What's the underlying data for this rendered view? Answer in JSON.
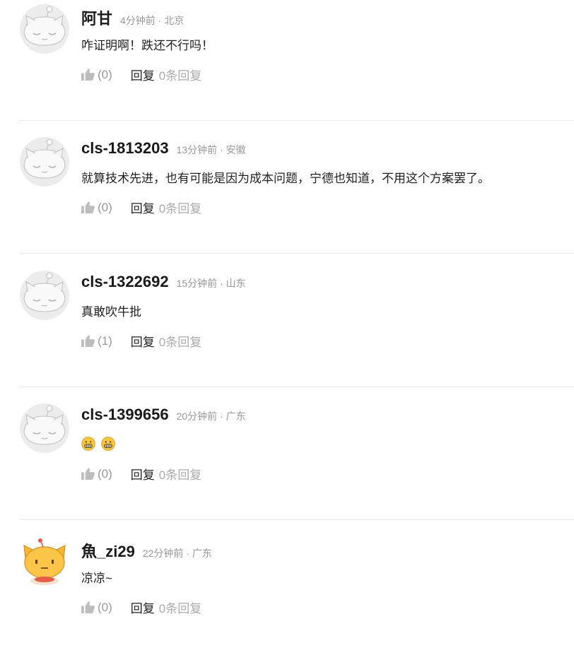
{
  "comments": [
    {
      "username": "阿甘",
      "meta": "4分钟前 · 北京",
      "text": "咋证明啊！跌还不行吗！",
      "likes": "(0)",
      "reply_label": "回复",
      "reply_count": "0条回复",
      "avatar": "default-cat-avatar"
    },
    {
      "username": "cls-1813203",
      "meta": "13分钟前 · 安徽",
      "text": "就算技术先进，也有可能是因为成本问题，宁德也知道，不用这个方案罢了。",
      "likes": "(0)",
      "reply_label": "回复",
      "reply_count": "0条回复",
      "avatar": "default-cat-avatar"
    },
    {
      "username": "cls-1322692",
      "meta": "15分钟前 · 山东",
      "text": "真敢吹牛批",
      "likes": "(1)",
      "reply_label": "回复",
      "reply_count": "0条回复",
      "avatar": "default-cat-avatar"
    },
    {
      "username": "cls-1399656",
      "meta": "20分钟前 · 广东",
      "text": "",
      "emojis": [
        "grimace-emoji",
        "grimace-emoji"
      ],
      "likes": "(0)",
      "reply_label": "回复",
      "reply_count": "0条回复",
      "avatar": "default-cat-avatar"
    },
    {
      "username": "魚_zi29",
      "meta": "22分钟前 · 广东",
      "text": "凉凉~",
      "likes": "(0)",
      "reply_label": "回复",
      "reply_count": "0条回复",
      "avatar": "yellow-cat-avatar"
    }
  ]
}
